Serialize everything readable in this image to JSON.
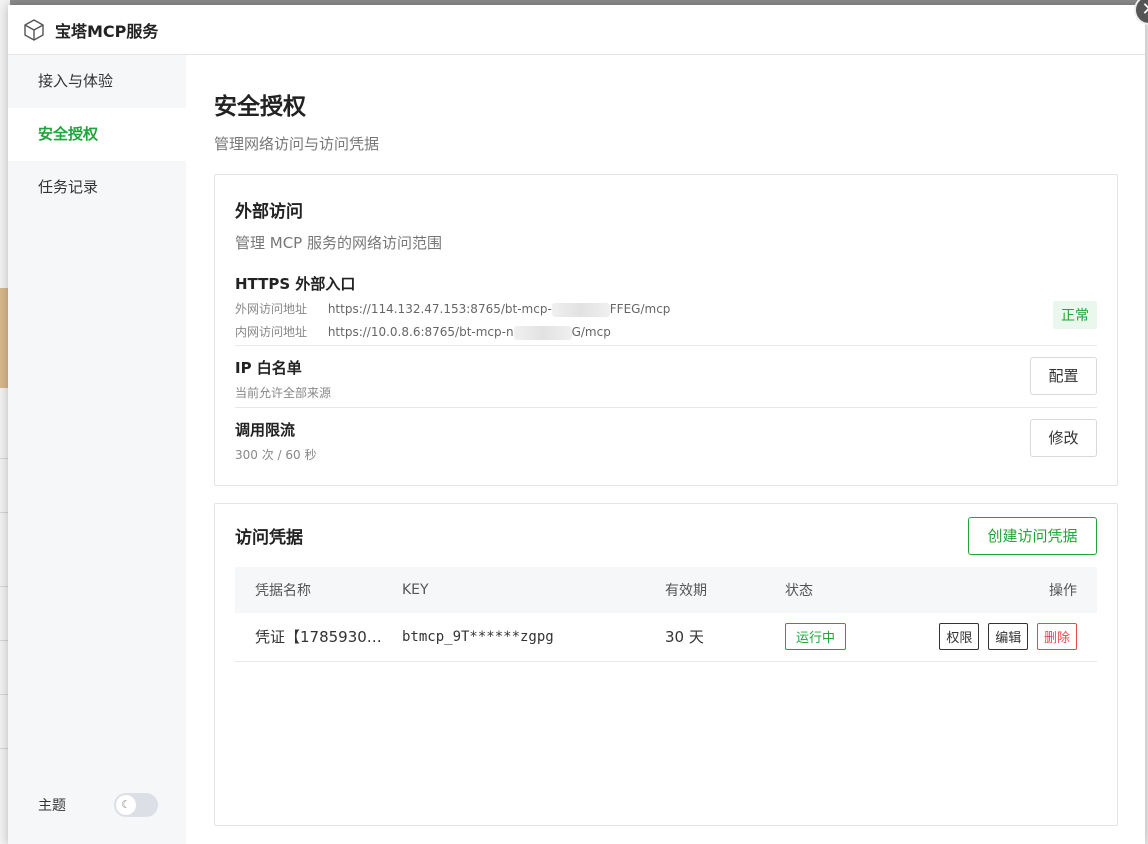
{
  "window": {
    "title": "宝塔MCP服务"
  },
  "sidebar": {
    "items": [
      {
        "label": "接入与体验"
      },
      {
        "label": "安全授权"
      },
      {
        "label": "任务记录"
      }
    ],
    "active_index": 1,
    "theme_label": "主题"
  },
  "page": {
    "title": "安全授权",
    "subtitle": "管理网络访问与访问凭据"
  },
  "external": {
    "title": "外部访问",
    "subtitle": "管理 MCP 服务的网络访问范围",
    "https": {
      "title": "HTTPS 外部入口",
      "public_label": "外网访问地址",
      "public_prefix": "https://114.132.47.153:8765/bt-mcp-",
      "public_suffix": "FFEG/mcp",
      "private_label": "内网访问地址",
      "private_prefix": "https://10.0.8.6:8765/bt-mcp-n",
      "private_suffix": "G/mcp",
      "status": "正常"
    },
    "ip_whitelist": {
      "title": "IP 白名单",
      "desc": "当前允许全部来源",
      "button": "配置"
    },
    "rate_limit": {
      "title": "调用限流",
      "desc": "300 次 / 60 秒",
      "button": "修改"
    }
  },
  "credentials": {
    "title": "访问凭据",
    "create_button": "创建访问凭据",
    "columns": [
      "凭据名称",
      "KEY",
      "有效期",
      "状态",
      "操作"
    ],
    "rows": [
      {
        "name": "凭证【1785930…",
        "key": "btmcp_9T******zgpg",
        "expiry": "30 天",
        "status": "运行中",
        "actions": [
          "权限",
          "编辑",
          "删除"
        ]
      }
    ]
  },
  "colors": {
    "accent": "#20a53a",
    "danger": "#e5484d"
  }
}
